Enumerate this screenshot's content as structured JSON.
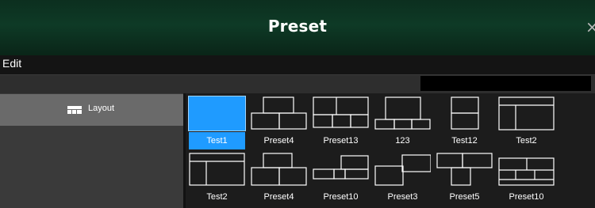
{
  "window": {
    "title": "Preset",
    "close_glyph": "×"
  },
  "menu": {
    "items": [
      {
        "label": "Edit"
      }
    ]
  },
  "search": {
    "value": "",
    "icon": "search-icon"
  },
  "sidebar": {
    "items": [
      {
        "label": "Layout",
        "icon": "grid-layout-icon",
        "selected": true
      }
    ]
  },
  "presets": [
    {
      "label": "Test1",
      "selected": true,
      "layout": "single"
    },
    {
      "label": "Preset4",
      "selected": false,
      "layout": "two-over-three"
    },
    {
      "label": "Preset13",
      "selected": false,
      "layout": "two-over-three-wide"
    },
    {
      "label": "123",
      "selected": false,
      "layout": "one-over-three"
    },
    {
      "label": "Test12",
      "selected": false,
      "layout": "two-stacked"
    },
    {
      "label": "Test2",
      "selected": false,
      "layout": "top-bar-split"
    },
    {
      "label": "Test2",
      "selected": false,
      "layout": "top-bar-split-alt"
    },
    {
      "label": "Preset4",
      "selected": false,
      "layout": "one-over-two"
    },
    {
      "label": "Preset10",
      "selected": false,
      "layout": "mixed-1"
    },
    {
      "label": "Preset3",
      "selected": false,
      "layout": "offset-2"
    },
    {
      "label": "Preset5",
      "selected": false,
      "layout": "three-offset"
    },
    {
      "label": "Preset10",
      "selected": false,
      "layout": "mixed-2"
    }
  ],
  "colors": {
    "accent": "#1f9bff",
    "titlebar": "#0e3a26"
  }
}
